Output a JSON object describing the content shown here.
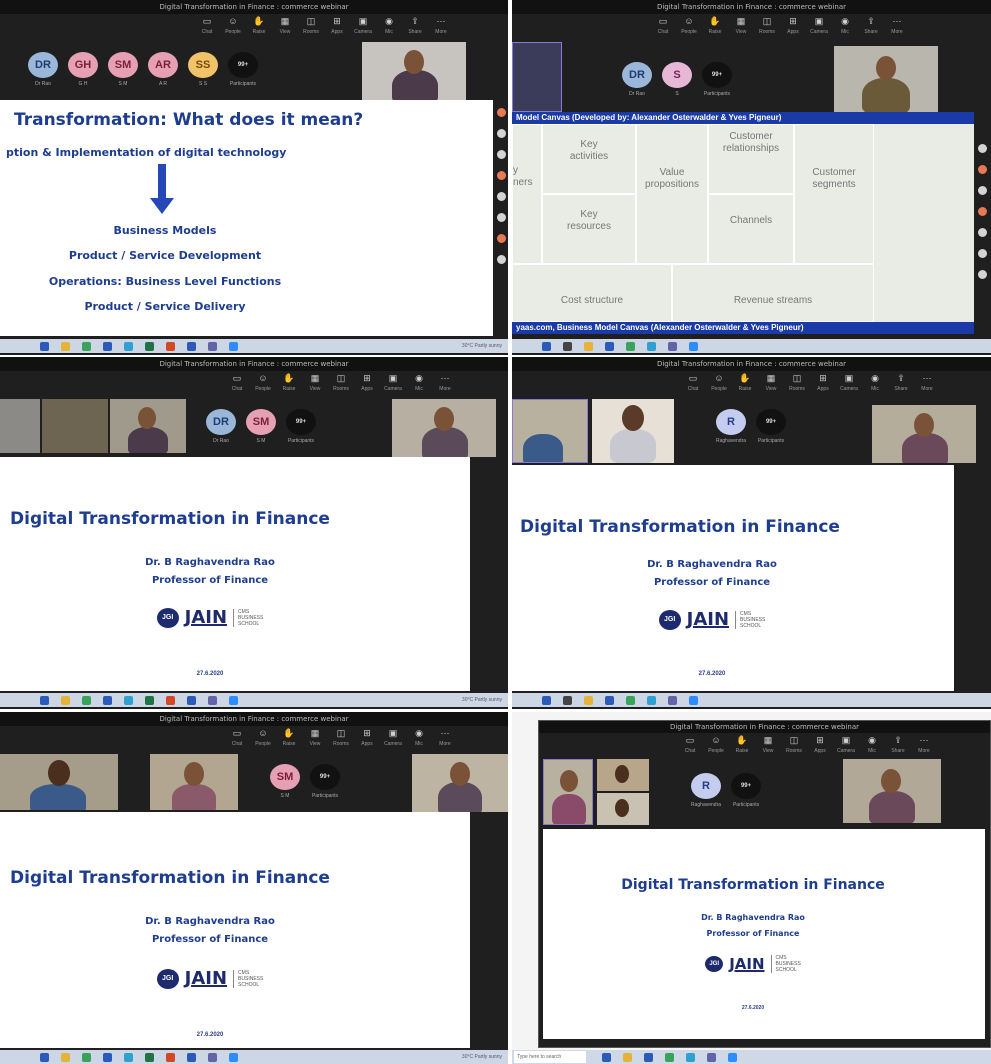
{
  "toolbar": {
    "items": [
      "Chat",
      "People",
      "Raise",
      "View",
      "Rooms",
      "Apps",
      "More",
      "Leave",
      "Camera",
      "Mic",
      "Share"
    ]
  },
  "taskbar": {
    "status": "30°C Partly sunny",
    "search": "Type here to search"
  },
  "panels": [
    {
      "window_title": "Digital Transformation in Finance : commerce webinar",
      "avatars": [
        {
          "initials": "DR",
          "name": "Dr Rao",
          "color": "#9ab7d9"
        },
        {
          "initials": "GH",
          "name": "G H",
          "color": "#e6a0b4"
        },
        {
          "initials": "SM",
          "name": "S M",
          "color": "#e6a0b4"
        },
        {
          "initials": "AR",
          "name": "A R",
          "color": "#e6a0b4"
        },
        {
          "initials": "SS",
          "name": "S S",
          "color": "#f0c36a"
        },
        {
          "initials": "99+",
          "name": "Participants",
          "color": "#111111"
        }
      ],
      "slide": {
        "title": "Transformation: What does it mean?",
        "subtitle": "ption & Implementation of digital technology",
        "items": [
          "Business Models",
          "Product / Service Development",
          "Operations: Business Level Functions",
          "Product / Service Delivery"
        ]
      }
    },
    {
      "window_title": "Digital Transformation in Finance : commerce webinar",
      "avatars": [
        {
          "initials": "DR",
          "name": "Dr Rao",
          "color": "#9ab7d9"
        },
        {
          "initials": "S",
          "name": "S",
          "color": "#e6b8d6"
        },
        {
          "initials": "99+",
          "name": "Participants",
          "color": "#111111"
        }
      ],
      "slide": {
        "header": "Model Canvas (Developed by: Alexander Osterwalder & Yves Pigneur)",
        "footer": "yaas.com, Business Model Canvas (Alexander Osterwalder & Yves Pigneur)",
        "cells": {
          "key_partners": "y\nners",
          "key_activities": "Key\nactivities",
          "value_propositions": "Value\npropositions",
          "customer_relationships": "Customer\nrelationships",
          "customer_segments": "Customer\nsegments",
          "key_resources": "Key\nresources",
          "channels": "Channels",
          "cost_structure": "Cost structure",
          "revenue_streams": "Revenue streams"
        }
      }
    },
    {
      "window_title": "Digital Transformation in Finance : commerce webinar",
      "avatars": [
        {
          "initials": "DR",
          "name": "Dr Rao",
          "color": "#9ab7d9"
        },
        {
          "initials": "SM",
          "name": "S M",
          "color": "#e6a0b4"
        },
        {
          "initials": "99+",
          "name": "Participants",
          "color": "#111111"
        }
      ]
    },
    {
      "window_title": "Digital Transformation in Finance : commerce webinar",
      "avatars": [
        {
          "initials": "R",
          "name": "Raghavendra",
          "color": "#c4cdf0"
        },
        {
          "initials": "99+",
          "name": "Participants",
          "color": "#111111"
        }
      ]
    },
    {
      "window_title": "Digital Transformation in Finance : commerce webinar",
      "avatars": [
        {
          "initials": "SM",
          "name": "S M",
          "color": "#e6a0b4"
        },
        {
          "initials": "99+",
          "name": "Participants",
          "color": "#111111"
        }
      ]
    },
    {
      "window_title": "Digital Transformation in Finance : commerce webinar",
      "avatars": [
        {
          "initials": "R",
          "name": "Raghavendra",
          "color": "#c4cdf0"
        },
        {
          "initials": "99+",
          "name": "Participants",
          "color": "#111111"
        }
      ]
    }
  ],
  "title_slide": {
    "title": "Digital Transformation in Finance",
    "presenter": "Dr. B Raghavendra Rao",
    "role": "Professor of Finance",
    "logo_mark": "JGI",
    "logo_word": "JAIN",
    "logo_side": "CMS\nBUSINESS\nSCHOOL",
    "date": "27.6.2020"
  }
}
